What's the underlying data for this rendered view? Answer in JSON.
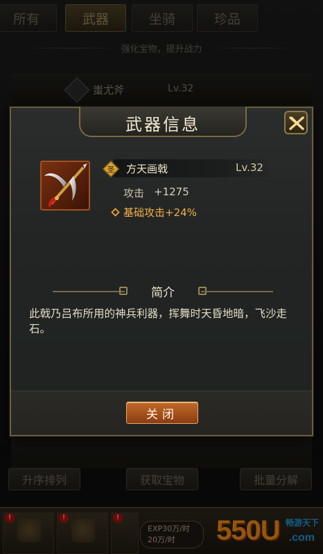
{
  "tabs": [
    {
      "label": "所有",
      "active": false
    },
    {
      "label": "武器",
      "active": true
    },
    {
      "label": "坐骑",
      "active": false
    },
    {
      "label": "珍品",
      "active": false
    }
  ],
  "subtitle": "强化宝物，提升战力",
  "background_items": [
    {
      "name": "蚩尤斧",
      "level": "Lv.32"
    }
  ],
  "bottom_buttons": {
    "sort": "升序排列",
    "obtain": "获取宝物",
    "batch": "批量分解"
  },
  "navbar": {
    "exp_line": "EXP30万/时",
    "silver_line": "20万/时"
  },
  "watermark": {
    "main": "550U",
    "side": "畅游天下",
    "com": ".com"
  },
  "dialog": {
    "title": "武器信息",
    "weapon": {
      "rank_badge": "圣",
      "name": "方天画戟",
      "level": "Lv.32",
      "attack_label": "攻击",
      "attack_value": "+1275",
      "bonus": "基础攻击+24%"
    },
    "intro_title": "简介",
    "description": "此戟乃吕布所用的神兵利器，挥舞时天昏地暗，飞沙走石。",
    "close_label": "关闭"
  },
  "colors": {
    "accent_gold": "#7c6a42",
    "bonus_orange": "#f0b048",
    "button_orange": "#c16a2a"
  }
}
